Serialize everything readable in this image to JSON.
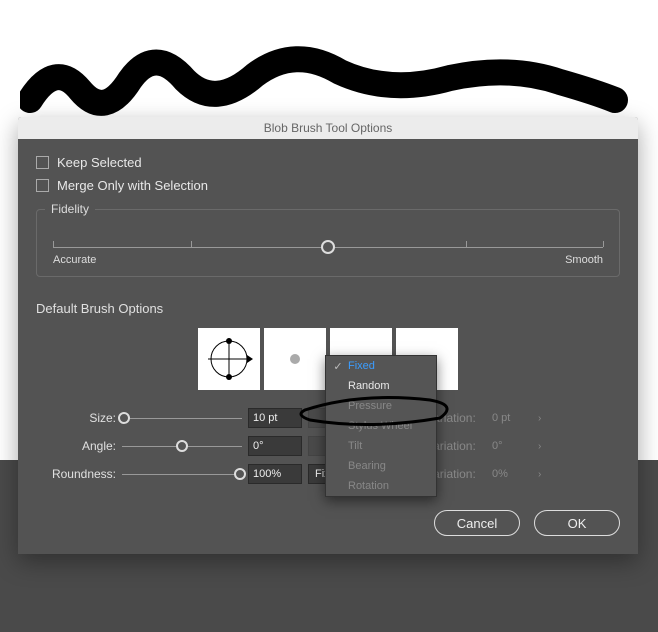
{
  "dialog": {
    "title": "Blob Brush Tool Options",
    "checkboxes": {
      "keep_selected": "Keep Selected",
      "merge_only": "Merge Only with Selection"
    },
    "fidelity": {
      "title": "Fidelity",
      "left_label": "Accurate",
      "right_label": "Smooth"
    },
    "default_brush_title": "Default Brush Options",
    "controls": {
      "size": {
        "label": "Size:",
        "value": "10 pt",
        "variation_label": "Variation:",
        "variation_value": "0 pt"
      },
      "angle": {
        "label": "Angle:",
        "value": "0°",
        "variation_label": "Variation:",
        "variation_value": "0°"
      },
      "roundness": {
        "label": "Roundness:",
        "value": "100%",
        "dropdown_value": "Fixed",
        "variation_label": "Variation:",
        "variation_value": "0%"
      }
    },
    "dropdown_menu": {
      "items": [
        {
          "label": "Fixed",
          "selected": true,
          "enabled": true
        },
        {
          "label": "Random",
          "selected": false,
          "enabled": true
        },
        {
          "label": "Pressure",
          "selected": false,
          "enabled": false
        },
        {
          "label": "Stylus Wheel",
          "selected": false,
          "enabled": false
        },
        {
          "label": "Tilt",
          "selected": false,
          "enabled": false
        },
        {
          "label": "Bearing",
          "selected": false,
          "enabled": false
        },
        {
          "label": "Rotation",
          "selected": false,
          "enabled": false
        }
      ]
    },
    "buttons": {
      "cancel": "Cancel",
      "ok": "OK"
    }
  }
}
